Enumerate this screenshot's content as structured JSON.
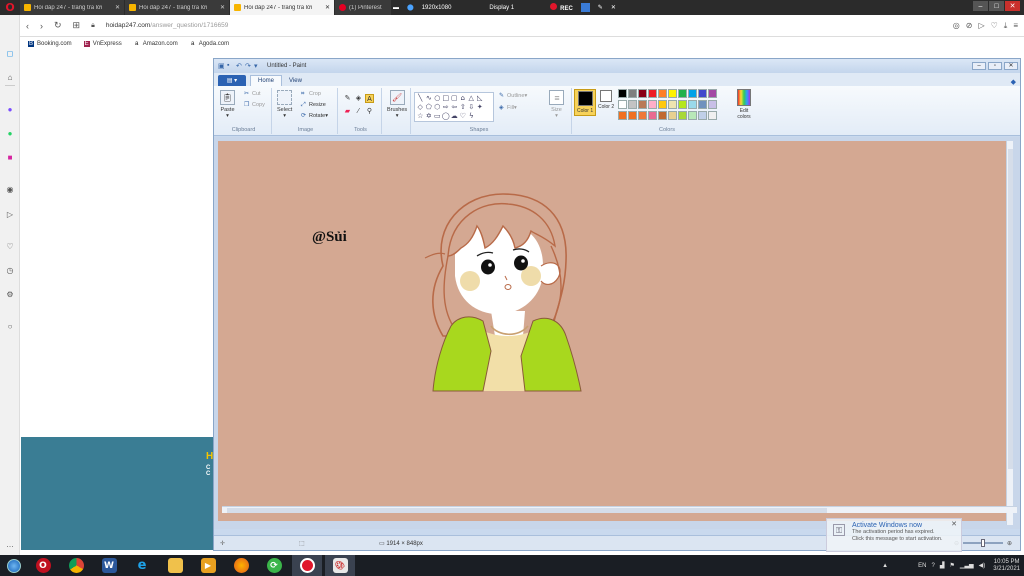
{
  "browser": {
    "tabs": [
      {
        "label": "Hỏi đáp 247 - trang tra lời",
        "active": false
      },
      {
        "label": "Hỏi đáp 247 - trang tra lời",
        "active": false
      },
      {
        "label": "Hỏi đáp 247 - trang tra lời",
        "active": true
      },
      {
        "label": "(1) Pinterest",
        "active": false
      }
    ],
    "close_symbol": "✕",
    "recorder": {
      "resolution": "1920x1080",
      "display": "Display 1",
      "rec": "REC"
    },
    "url": {
      "host": "hoidap247.com",
      "path": "/answer_question/1716659"
    },
    "bookmarks": [
      "Booking.com",
      "VnExpress",
      "Amazon.com",
      "Agoda.com"
    ]
  },
  "page": {
    "strip_letters": [
      "H",
      "C",
      "C"
    ]
  },
  "paint": {
    "title": "Untitled - Paint",
    "file_tab": "▤ ▾",
    "tabs": [
      "Home",
      "View"
    ],
    "clipboard": {
      "label": "Clipboard",
      "paste": "Paste",
      "cut": "Cut",
      "copy": "Copy"
    },
    "image": {
      "label": "Image",
      "select": "Select",
      "crop": "Crop",
      "resize": "Resize",
      "rotate": "Rotate"
    },
    "tools": {
      "label": "Tools",
      "brushes": "Brushes"
    },
    "shapes": {
      "label": "Shapes",
      "outline": "Outline",
      "fill": "Fill"
    },
    "size_label": "Size",
    "colors": {
      "label": "Colors",
      "color1": "Color 1",
      "color2": "Color 2",
      "edit": "Edit colors",
      "color1_value": "#000000",
      "color2_value": "#ffffff",
      "palette": [
        "#000000",
        "#7f7f7f",
        "#880015",
        "#ed1c24",
        "#ff7f27",
        "#fff200",
        "#22b14c",
        "#00a2e8",
        "#3f48cc",
        "#a349a4",
        "#ffffff",
        "#c3c3c3",
        "#b97a57",
        "#ffaec9",
        "#ffc90e",
        "#efe4b0",
        "#b5e61d",
        "#99d9ea",
        "#7092be",
        "#c8bfe7",
        "#f07020",
        "#f07020",
        "#ee7838",
        "#e86a90",
        "#c06a30",
        "#e8d090",
        "#a8d838",
        "#b8e8b8",
        "#c0d0e8",
        "#f0f0f0"
      ]
    },
    "canvas": {
      "background": "#d4a892",
      "watermark": "@Sủi"
    },
    "status": {
      "size": "1914 × 848px"
    }
  },
  "toast": {
    "title": "Activate Windows now",
    "line1": "The activation period has expired.",
    "line2": "Click this message to start activation."
  },
  "taskbar": {
    "time": "10:05 PM",
    "date": "3/21/2021",
    "lang": "EN"
  }
}
